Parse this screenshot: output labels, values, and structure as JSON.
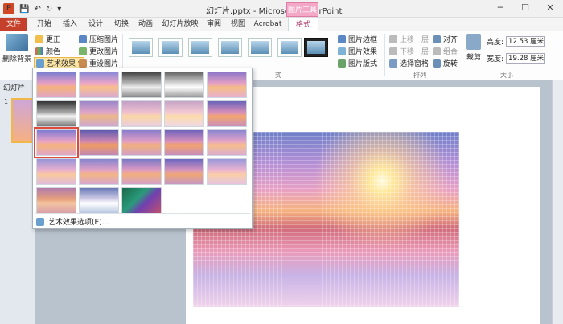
{
  "title_bar": {
    "app_icon": "P",
    "title": "幻灯片.pptx - Microsoft PowerPoint",
    "context_tab": "图片工具",
    "minimize": "─",
    "maximize": "☐",
    "close": "✕"
  },
  "tabs": {
    "file": "文件",
    "items": [
      "开始",
      "插入",
      "设计",
      "切换",
      "动画",
      "幻灯片放映",
      "审阅",
      "视图",
      "Acrobat",
      "格式"
    ],
    "active": "格式"
  },
  "ribbon": {
    "remove_bg": "删除背景",
    "corrections": "更正",
    "color": "颜色",
    "artistic_effects": "艺术效果",
    "compress": "压缩图片",
    "change": "更改图片",
    "reset": "重设图片",
    "picture_border": "图片边框",
    "picture_effects": "图片效果",
    "picture_layout": "图片版式",
    "bring_forward": "上移一层",
    "send_backward": "下移一层",
    "selection_pane": "选择窗格",
    "align": "对齐",
    "group": "组合",
    "rotate": "旋转",
    "crop": "裁剪",
    "height_label": "高度:",
    "height_value": "12.53 厘米",
    "width_label": "宽度:",
    "width_value": "19.28 厘米",
    "group_styles_tail": "式",
    "group_arrange": "排列",
    "group_size": "大小"
  },
  "left_panel": {
    "tab_label": "幻灯片",
    "slide_number": "1"
  },
  "dropdown": {
    "selected_index": 10,
    "options_label": "艺术效果选项(E)..."
  }
}
